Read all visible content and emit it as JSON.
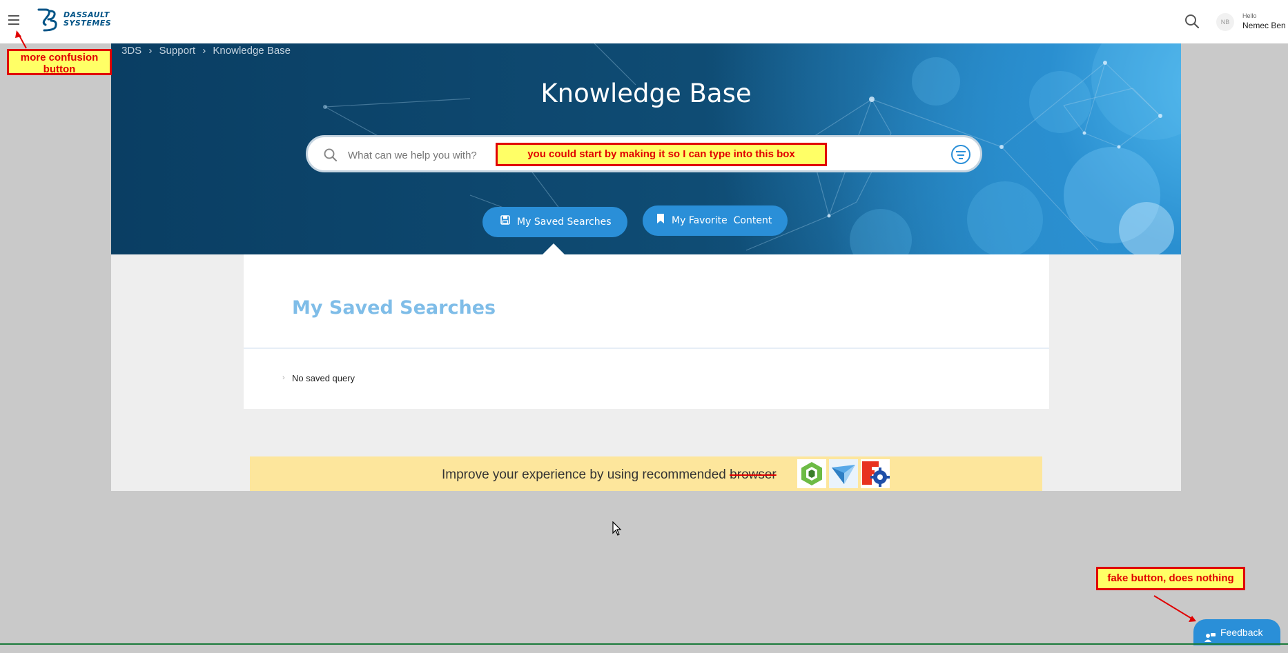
{
  "header": {
    "logo_text_line1": "DASSAULT",
    "logo_text_line2": "SYSTEMES",
    "user_initials": "NB",
    "greeting": "Hello",
    "username": "Nemec Ben"
  },
  "breadcrumb": [
    "3DS",
    "Support",
    "Knowledge Base"
  ],
  "hero": {
    "title": "Knowledge Base",
    "search_placeholder": "What can we help you with?"
  },
  "tabs": {
    "saved_searches": "My Saved Searches",
    "favorite_content": "My Favorite  Content"
  },
  "panel": {
    "title": "My Saved Searches",
    "empty_text": "No saved query"
  },
  "banner": {
    "text": "Improve your experience by using recommended",
    "struck_word": "browser"
  },
  "feedback": {
    "label": "Feedback"
  },
  "annotations": {
    "menu_note": "more confusion button",
    "search_note": "you could start by making it so I can type into this box",
    "feedback_note": "fake button, does nothing"
  },
  "colors": {
    "accent": "#2a8fd8",
    "annotation_red": "#e00000",
    "annotation_yellow": "#ffff66",
    "banner": "#fde69c"
  }
}
